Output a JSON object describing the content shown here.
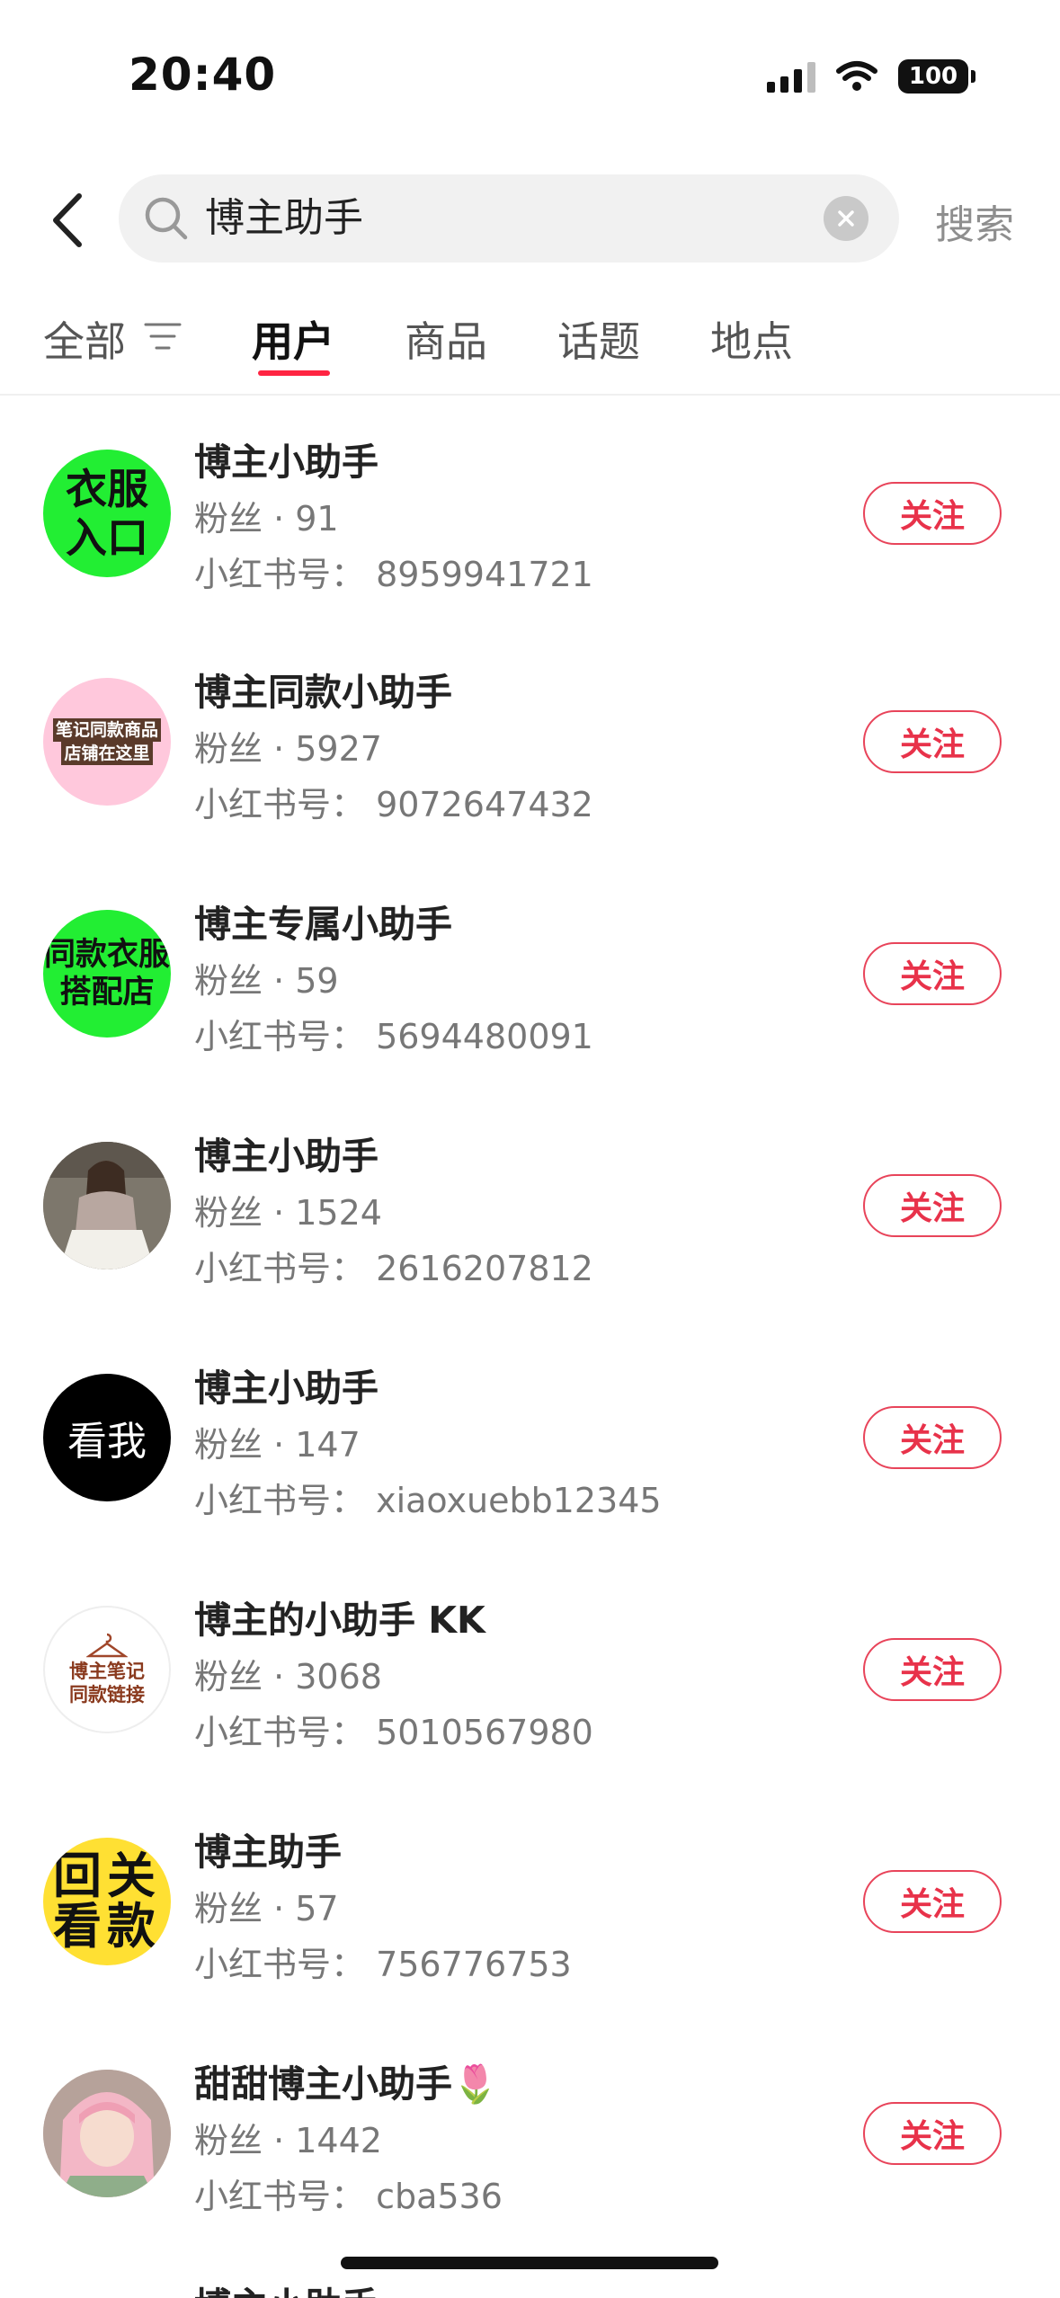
{
  "status_bar": {
    "time": "20:40",
    "battery": "100"
  },
  "search": {
    "query": "博主助手",
    "button": "搜索"
  },
  "tabs": [
    {
      "label": "全部"
    },
    {
      "label": "用户"
    },
    {
      "label": "商品"
    },
    {
      "label": "话题"
    },
    {
      "label": "地点"
    }
  ],
  "users": [
    {
      "name": "博主小助手",
      "fans": "粉丝 · 91",
      "id": "小红书号： 8959941721",
      "follow": "关注",
      "avatar_text": [
        "衣服",
        "入口"
      ]
    },
    {
      "name": "博主同款小助手",
      "fans": "粉丝 · 5927",
      "id": "小红书号： 9072647432",
      "follow": "关注",
      "avatar_text": [
        "笔记同款商品",
        "店铺在这里"
      ]
    },
    {
      "name": "博主专属小助手",
      "fans": "粉丝 · 59",
      "id": "小红书号： 5694480091",
      "follow": "关注",
      "avatar_text": [
        "同款衣服",
        "搭配店"
      ]
    },
    {
      "name": "博主小助手",
      "fans": "粉丝 · 1524",
      "id": "小红书号： 2616207812",
      "follow": "关注",
      "avatar_text": []
    },
    {
      "name": "博主小助手",
      "fans": "粉丝 · 147",
      "id": "小红书号： xiaoxuebb12345",
      "follow": "关注",
      "avatar_text": [
        "看我"
      ]
    },
    {
      "name": "博主的小助手 KK",
      "fans": "粉丝 · 3068",
      "id": "小红书号： 5010567980",
      "follow": "关注",
      "avatar_text": [
        "博主笔记",
        "同款链接"
      ]
    },
    {
      "name": "博主助手",
      "fans": "粉丝 · 57",
      "id": "小红书号： 756776753",
      "follow": "关注",
      "avatar_text": [
        "回关",
        "看款"
      ]
    },
    {
      "name": "甜甜博主小助手🌷",
      "fans": "粉丝 · 1442",
      "id": "小红书号： cba536",
      "follow": "关注",
      "avatar_text": []
    }
  ],
  "partial_row": {
    "name": "博主小助手"
  },
  "colors": {
    "accent": "#ff2442",
    "follow_text": "#e8324a"
  }
}
